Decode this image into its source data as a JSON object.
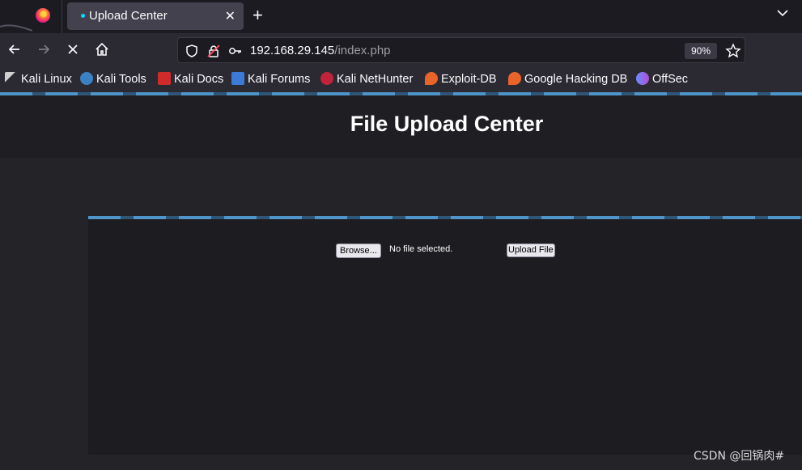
{
  "browser": {
    "tab": {
      "title": "Upload Center"
    },
    "new_tab_label": "+",
    "close_tab_label": "✕",
    "url": {
      "host": "192.168.29.145",
      "path": "/index.php"
    },
    "zoom": "90%"
  },
  "bookmarks": [
    {
      "label": "Kali Linux",
      "icon": "kali-dragon-icon",
      "color": "#cfcfcf"
    },
    {
      "label": "Kali Tools",
      "icon": "kali-tools-icon",
      "color": "#3b82c4"
    },
    {
      "label": "Kali Docs",
      "icon": "kali-docs-icon",
      "color": "#d02b2b"
    },
    {
      "label": "Kali Forums",
      "icon": "kali-forums-icon",
      "color": "#3c7ad6"
    },
    {
      "label": "Kali NetHunter",
      "icon": "kali-nethunter-icon",
      "color": "#c0233a"
    },
    {
      "label": "Exploit-DB",
      "icon": "exploit-db-icon",
      "color": "#e8642b"
    },
    {
      "label": "Google Hacking DB",
      "icon": "ghdb-icon",
      "color": "#e8642b"
    },
    {
      "label": "OffSec",
      "icon": "offsec-icon",
      "color": "#6b8cff"
    }
  ],
  "page": {
    "title": "File Upload Center",
    "browse_label": "Browse...",
    "file_status": "No file selected.",
    "upload_label": "Upload File"
  },
  "watermark": "CSDN @回锅肉#",
  "colors": {
    "accent_stripe": "#4f95c9",
    "page_bg": "#242327",
    "panel_bg": "#1d1c20"
  }
}
